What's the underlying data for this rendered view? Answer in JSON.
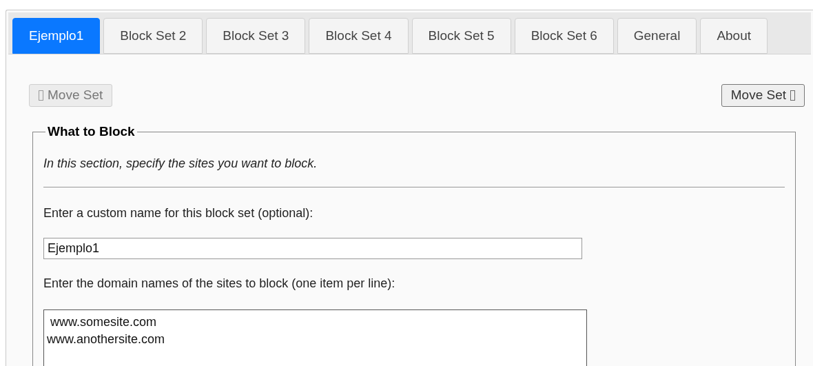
{
  "tabs": [
    {
      "label": "Ejemplo1",
      "selected": true
    },
    {
      "label": "Block Set 2",
      "selected": false
    },
    {
      "label": "Block Set 3",
      "selected": false
    },
    {
      "label": "Block Set 4",
      "selected": false
    },
    {
      "label": "Block Set 5",
      "selected": false
    },
    {
      "label": "Block Set 6",
      "selected": false
    },
    {
      "label": "General",
      "selected": false
    },
    {
      "label": "About",
      "selected": false
    }
  ],
  "move_buttons": [
    {
      "label": "Move Set",
      "disabled": true,
      "kind": "left"
    },
    {
      "label": "Move Set",
      "disabled": false,
      "kind": "right"
    }
  ],
  "fieldset": {
    "legend": "What to Block",
    "intro": "In this section, specify the sites you want to block.",
    "name_label": "Enter a custom name for this block set (optional):",
    "name_value": "Ejemplo1",
    "sites_label": "Enter the domain names of the sites to block (one item per line):",
    "sites_value": " www.somesite.com\nwww.anothersite.com"
  }
}
